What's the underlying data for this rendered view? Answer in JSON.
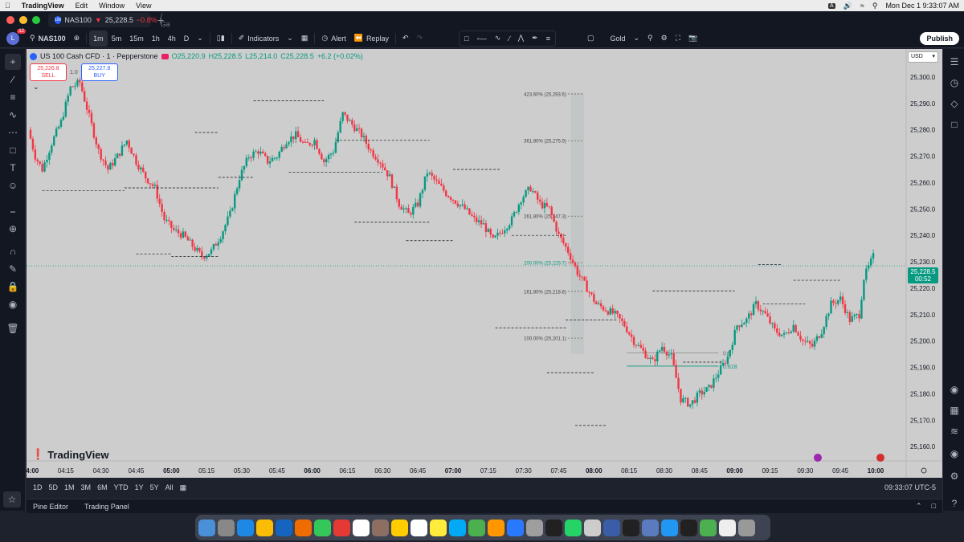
{
  "menubar": {
    "app": "TradingView",
    "items": [
      "Edit",
      "Window",
      "View"
    ],
    "input": "A",
    "datetime": "Mon Dec 1  9:33:07 AM"
  },
  "tab": {
    "title": "NAS100",
    "price": "25,228.5",
    "change": "−0.8%",
    "suffix": "/ Ga",
    "icon": "100"
  },
  "toolbar": {
    "avatar": "L",
    "badge": "12",
    "symbol": "NAS100",
    "intervals": [
      "1m",
      "5m",
      "15m",
      "1h",
      "4h",
      "D"
    ],
    "active_interval": "1m",
    "indicators": "Indicators",
    "alert": "Alert",
    "replay": "Replay",
    "layout_name": "Gold",
    "publish": "Publish"
  },
  "legend": {
    "title": "US 100 Cash CFD · 1 · Pepperstone",
    "o": "O25,220.9",
    "h": "H25,228.5",
    "l": "L25,214.0",
    "c": "C25,228.5",
    "chg": "+6.2 (+0.02%)",
    "sell_price": "25,226.8",
    "sell": "SELL",
    "qty": "1.0",
    "buy_price": "25,227.8",
    "buy": "BUY"
  },
  "currency": "USD",
  "watermark": "TradingView",
  "price_label": {
    "price": "25,228.5",
    "timer": "00:52"
  },
  "fib_labels": [
    {
      "text": "423.60% (25,293.6)",
      "price": 25293.6
    },
    {
      "text": "361.80% (25,275.9)",
      "price": 25275.9
    },
    {
      "text": "261.80% (25,247.3)",
      "price": 25247.3
    },
    {
      "text": "200.00% (25,229.7)",
      "price": 25229.7
    },
    {
      "text": "161.80% (25,218.8)",
      "price": 25218.8
    },
    {
      "text": "100.00% (25,201.1)",
      "price": 25201.1
    }
  ],
  "retrace_labels": [
    {
      "text": "0.5",
      "price": 25195.5
    },
    {
      "text": "0.618",
      "price": 25190.5
    }
  ],
  "bottombar": {
    "ranges": [
      "1D",
      "5D",
      "1M",
      "3M",
      "6M",
      "YTD",
      "1Y",
      "5Y",
      "All"
    ],
    "clock": "09:33:07 UTC-5"
  },
  "panelbar": {
    "pine": "Pine Editor",
    "trading": "Trading Panel"
  },
  "chart_data": {
    "type": "candlestick",
    "yticks": [
      25300,
      25290,
      25280,
      25270,
      25260,
      25250,
      25240,
      25230,
      25220,
      25210,
      25200,
      25190,
      25180,
      25170,
      25160
    ],
    "ylim": [
      25155.5,
      25301.5
    ],
    "xticks": [
      "04:00",
      "04:15",
      "04:30",
      "04:45",
      "05:00",
      "05:15",
      "05:30",
      "05:45",
      "06:00",
      "06:15",
      "06:30",
      "06:45",
      "07:00",
      "07:15",
      "07:30",
      "07:45",
      "08:00",
      "08:15",
      "08:30",
      "08:45",
      "09:00",
      "09:15",
      "09:30",
      "09:45",
      "10:00"
    ],
    "xticks_bold": [
      "04:00",
      "05:00",
      "06:00",
      "07:00",
      "08:00",
      "09:00",
      "10:00"
    ],
    "x_range_minutes": [
      0,
      360
    ],
    "path": [
      [
        0,
        25280
      ],
      [
        3,
        25270
      ],
      [
        6,
        25265
      ],
      [
        10,
        25275
      ],
      [
        14,
        25283
      ],
      [
        18,
        25296
      ],
      [
        22,
        25298
      ],
      [
        26,
        25285
      ],
      [
        30,
        25272
      ],
      [
        34,
        25265
      ],
      [
        38,
        25270
      ],
      [
        42,
        25276
      ],
      [
        46,
        25268
      ],
      [
        50,
        25262
      ],
      [
        54,
        25258
      ],
      [
        58,
        25246
      ],
      [
        62,
        25242
      ],
      [
        66,
        25240
      ],
      [
        70,
        25236
      ],
      [
        74,
        25232
      ],
      [
        78,
        25234
      ],
      [
        82,
        25240
      ],
      [
        86,
        25248
      ],
      [
        90,
        25262
      ],
      [
        94,
        25270
      ],
      [
        98,
        25272
      ],
      [
        102,
        25268
      ],
      [
        106,
        25270
      ],
      [
        110,
        25276
      ],
      [
        114,
        25278
      ],
      [
        118,
        25274
      ],
      [
        122,
        25276
      ],
      [
        126,
        25268
      ],
      [
        130,
        25272
      ],
      [
        134,
        25286
      ],
      [
        138,
        25282
      ],
      [
        142,
        25278
      ],
      [
        146,
        25272
      ],
      [
        150,
        25268
      ],
      [
        154,
        25262
      ],
      [
        158,
        25252
      ],
      [
        162,
        25248
      ],
      [
        166,
        25252
      ],
      [
        170,
        25264
      ],
      [
        174,
        25260
      ],
      [
        178,
        25256
      ],
      [
        182,
        25253
      ],
      [
        186,
        25250
      ],
      [
        190,
        25246
      ],
      [
        194,
        25244
      ],
      [
        198,
        25238
      ],
      [
        202,
        25242
      ],
      [
        206,
        25246
      ],
      [
        210,
        25254
      ],
      [
        214,
        25258
      ],
      [
        218,
        25252
      ],
      [
        222,
        25250
      ],
      [
        226,
        25240
      ],
      [
        230,
        25234
      ],
      [
        234,
        25226
      ],
      [
        238,
        25220
      ],
      [
        242,
        25214
      ],
      [
        246,
        25212
      ],
      [
        250,
        25210
      ],
      [
        254,
        25206
      ],
      [
        258,
        25200
      ],
      [
        262,
        25196
      ],
      [
        266,
        25192
      ],
      [
        270,
        25198
      ],
      [
        274,
        25194
      ],
      [
        278,
        25178
      ],
      [
        282,
        25176
      ],
      [
        286,
        25180
      ],
      [
        290,
        25182
      ],
      [
        294,
        25188
      ],
      [
        298,
        25194
      ],
      [
        302,
        25206
      ],
      [
        306,
        25208
      ],
      [
        310,
        25214
      ],
      [
        314,
        25210
      ],
      [
        318,
        25204
      ],
      [
        322,
        25202
      ],
      [
        326,
        25206
      ],
      [
        330,
        25200
      ],
      [
        334,
        25198
      ],
      [
        338,
        25204
      ],
      [
        342,
        25214
      ],
      [
        346,
        25216
      ],
      [
        350,
        25208
      ],
      [
        354,
        25210
      ],
      [
        356,
        25224
      ],
      [
        360,
        25232
      ]
    ]
  }
}
